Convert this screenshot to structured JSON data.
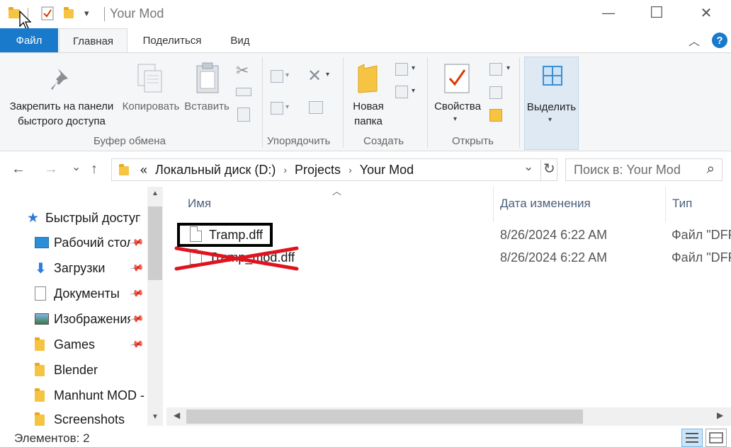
{
  "window": {
    "title": "Your Mod",
    "min_glyph": "—",
    "max_glyph": "☐",
    "close_glyph": "✕"
  },
  "quick_access_toolbar": {
    "dropdown_glyph": "▾"
  },
  "tabs": {
    "file": "Файл",
    "home": "Главная",
    "share": "Поделиться",
    "view": "Вид",
    "collapse_glyph": "︿",
    "help_glyph": "?"
  },
  "ribbon": {
    "pin": {
      "line1": "Закрепить на панели",
      "line2": "быстрого доступа"
    },
    "copy": "Копировать",
    "paste": "Вставить",
    "group_clipboard": "Буфер обмена",
    "group_organize": "Упорядочить",
    "new_folder": {
      "line1": "Новая",
      "line2": "папка"
    },
    "group_new": "Создать",
    "properties": "Свойства",
    "group_open": "Открыть",
    "select": "Выделить",
    "delete_glyph": "✕",
    "cut_glyph": "✂"
  },
  "nav": {
    "back_glyph": "←",
    "forward_glyph": "→",
    "recent_glyph": "⌄",
    "up_glyph": "↑",
    "breadcrumb_overflow": "«",
    "breadcrumbs": [
      "Локальный диск (D:)",
      "Projects",
      "Your Mod"
    ],
    "crumb_sep": "›",
    "address_dropdown_glyph": "⌄",
    "refresh_glyph": "↻",
    "search_placeholder": "Поиск в: Your Mod",
    "search_glyph": "⌕"
  },
  "sidebar": {
    "quick_access": "Быстрый доступ",
    "items": [
      {
        "label": "Рабочий стол",
        "icon": "desktop-icon",
        "pinned": true
      },
      {
        "label": "Загрузки",
        "icon": "downloads-icon",
        "pinned": true
      },
      {
        "label": "Документы",
        "icon": "documents-icon",
        "pinned": true
      },
      {
        "label": "Изображения",
        "icon": "pictures-icon",
        "pinned": true
      },
      {
        "label": "Games",
        "icon": "folder-icon",
        "pinned": true
      },
      {
        "label": "Blender",
        "icon": "folder-icon",
        "pinned": false
      },
      {
        "label": "Manhunt MOD -",
        "icon": "folder-icon",
        "pinned": false
      },
      {
        "label": "Screenshots",
        "icon": "folder-icon",
        "pinned": false
      }
    ],
    "pin_glyph": "📌"
  },
  "file_list": {
    "sort_glyph": "︿",
    "columns": {
      "name": "Имя",
      "date": "Дата изменения",
      "type": "Тип"
    },
    "rows": [
      {
        "name": "Tramp.dff",
        "date": "8/26/2024 6:22 AM",
        "type": "Файл \"DFF\"",
        "highlighted": true,
        "struck": false
      },
      {
        "name": "Tramp_mod.dff",
        "date": "8/26/2024 6:22 AM",
        "type": "Файл \"DFF\"",
        "highlighted": false,
        "struck": true
      }
    ]
  },
  "status": {
    "items_count": "Элементов: 2"
  },
  "colors": {
    "accent": "#1979ca",
    "strike": "#e0141e",
    "highlight_border": "#000000"
  }
}
